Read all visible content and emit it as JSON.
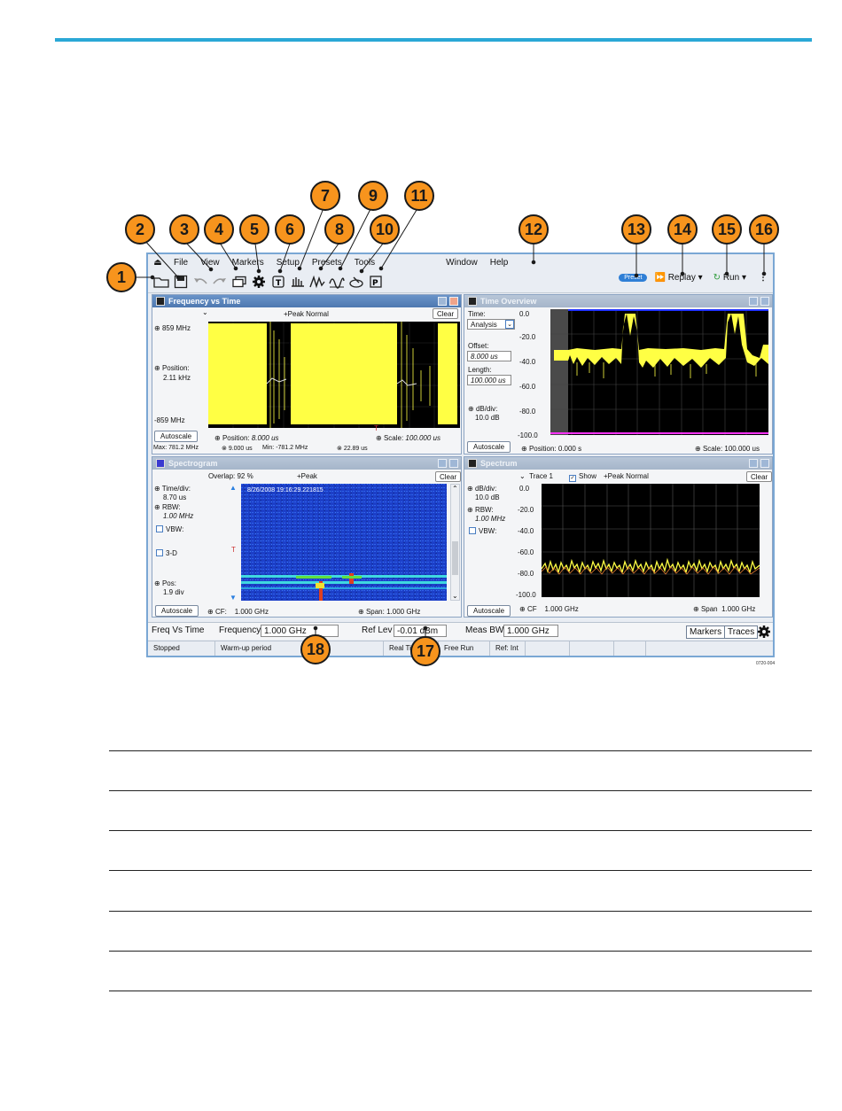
{
  "callouts": [
    "1",
    "2",
    "3",
    "4",
    "5",
    "6",
    "7",
    "8",
    "9",
    "10",
    "11",
    "12",
    "13",
    "14",
    "15",
    "16",
    "17",
    "18"
  ],
  "menu": {
    "items": [
      "File",
      "View",
      "Markers",
      "Setup",
      "Presets",
      "Tools",
      "Window",
      "Help"
    ]
  },
  "toolbar": {
    "icons": [
      "open-folder-icon",
      "save-icon",
      "undo-icon",
      "redo-icon",
      "windows-icon",
      "gear-icon",
      "trigger-icon",
      "acquire-icon",
      "analysis-icon",
      "amplitude-icon",
      "recall-icon",
      "presets-icon"
    ],
    "preset_label": "Preset",
    "replay_label": "Replay",
    "run_label": "Run"
  },
  "freq_time": {
    "title": "Frequency vs Time",
    "trace": "+Peak Normal",
    "clear": "Clear",
    "top": "859 MHz",
    "pos_label": "Position:",
    "pos_value": "2.11 kHz",
    "bottom": "-859 MHz",
    "autoscale": "Autoscale",
    "position_label": "Position:",
    "position_value": "8.000 us",
    "scale_label": "Scale:",
    "scale_value": "100.000 us",
    "max_label": "Max:",
    "max_value": "781.2 MHz",
    "t1": "9.000 us",
    "min_label": "Min:",
    "min_value": "-781.2 MHz",
    "t2": "22.89 us"
  },
  "time_overview": {
    "title": "Time Overview",
    "time_label": "Time:",
    "time_select": "Analysis",
    "offset_label": "Offset:",
    "offset_value": "8.000 us",
    "length_label": "Length:",
    "length_value": "100.000 us",
    "dbdiv_label": "dB/div:",
    "dbdiv_value": "10.0 dB",
    "yticks": [
      "0.0",
      "-20.0",
      "-40.0",
      "-60.0",
      "-80.0",
      "-100.0"
    ],
    "autoscale": "Autoscale",
    "position_label": "Position:",
    "position_value": "0.000 s",
    "scale_label": "Scale:",
    "scale_value": "100.000 us"
  },
  "spectrogram": {
    "title": "Spectrogram",
    "overlap": "Overlap: 92 %",
    "trace": "+Peak",
    "clear": "Clear",
    "timediv_label": "Time/div:",
    "timediv_value": "8.70 us",
    "rbw_label": "RBW:",
    "rbw_value": "1.00 MHz",
    "vbw": "VBW:",
    "threed": "3-D",
    "pos_label": "Pos:",
    "pos_value": "1.9 div",
    "timestamp": "8/26/2008 19:16:29.221815",
    "autoscale": "Autoscale",
    "cf_label": "CF:",
    "cf_value": "1.000 GHz",
    "span_label": "Span:",
    "span_value": "1.000 GHz"
  },
  "spectrum": {
    "title": "Spectrum",
    "trace": "Trace 1",
    "show": "Show",
    "detector": "+Peak Normal",
    "clear": "Clear",
    "dbdiv_label": "dB/div:",
    "dbdiv_value": "10.0 dB",
    "rbw_label": "RBW:",
    "rbw_value": "1.00 MHz",
    "vbw": "VBW:",
    "yticks": [
      "0.0",
      "-20.0",
      "-40.0",
      "-60.0",
      "-80.0",
      "-100.0"
    ],
    "autoscale": "Autoscale",
    "cf_label": "CF",
    "cf_value": "1.000 GHz",
    "span_label": "Span",
    "span_value": "1.000 GHz"
  },
  "bottom": {
    "view_name": "Freq Vs Time",
    "freq_label": "Frequency",
    "freq_value": "1.000 GHz",
    "reflev_label": "Ref Lev",
    "reflev_value": "-0.01 dBm",
    "measbw_label": "Meas BW",
    "measbw_value": "1.000 GHz",
    "markers": "Markers",
    "traces": "Traces"
  },
  "status": {
    "state": "Stopped",
    "warmup": "Warm-up period",
    "realtime": "Real Time",
    "run_mode": "Free Run",
    "ref": "Ref: Int"
  },
  "figure_code": "0720-004",
  "colors": {
    "accent": "#2aa8d6",
    "callout": "#f7941d",
    "trace_yellow": "#ffff44"
  }
}
